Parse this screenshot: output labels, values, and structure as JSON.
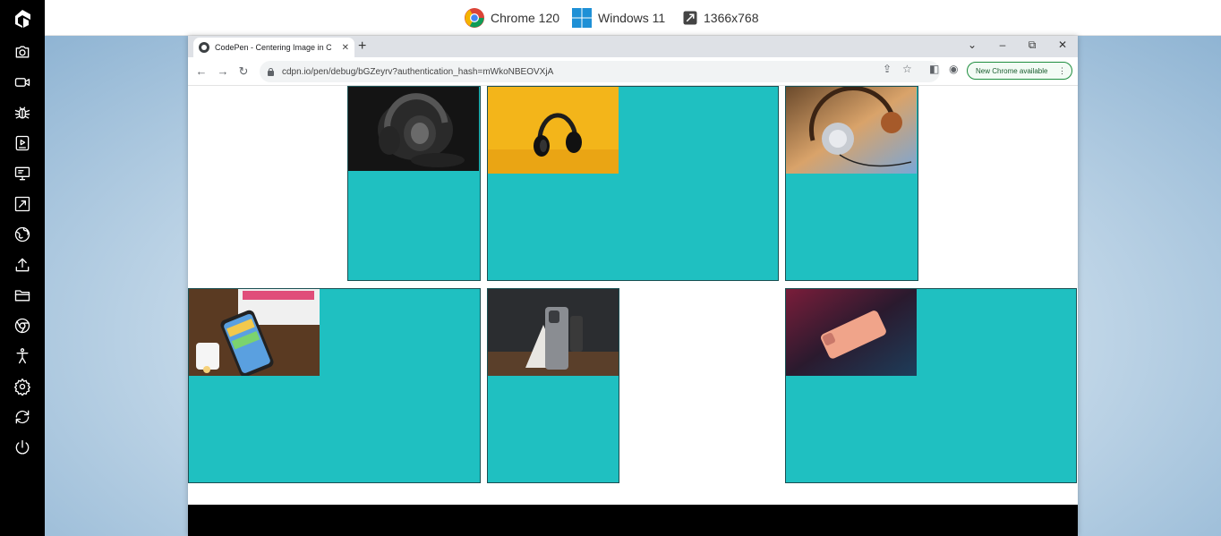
{
  "topbar": {
    "browser_label": "Chrome 120",
    "os_label": "Windows 11",
    "resolution_label": "1366x768"
  },
  "sidebar": {
    "items": [
      {
        "name": "camera-icon"
      },
      {
        "name": "video-icon"
      },
      {
        "name": "bug-icon"
      },
      {
        "name": "play-screen-icon"
      },
      {
        "name": "monitor-icon"
      },
      {
        "name": "resize-icon"
      },
      {
        "name": "globe-icon"
      },
      {
        "name": "upload-icon"
      },
      {
        "name": "folder-icon"
      },
      {
        "name": "chrome-icon"
      },
      {
        "name": "accessibility-icon"
      },
      {
        "name": "settings-icon"
      },
      {
        "name": "sync-icon"
      },
      {
        "name": "power-icon"
      }
    ]
  },
  "browser": {
    "tab_title": "CodePen - Centering Image in C",
    "url": "cdpn.io/pen/debug/bGZeyrv?authentication_hash=mWkoNBEOVXjA",
    "update_badge": "New Chrome available"
  },
  "colors": {
    "card_fill": "#1fc0c1",
    "card_border": "#1a4f52"
  },
  "gallery": {
    "cards": [
      {
        "image": "black headphones on dark background"
      },
      {
        "image": "black headphones on yellow background"
      },
      {
        "image": "silver and wood headphones"
      },
      {
        "image": "iphone with box and airpods"
      },
      {
        "image": "iphone standing on desk"
      },
      {
        "image": "pink iphone on dark desk"
      }
    ]
  }
}
